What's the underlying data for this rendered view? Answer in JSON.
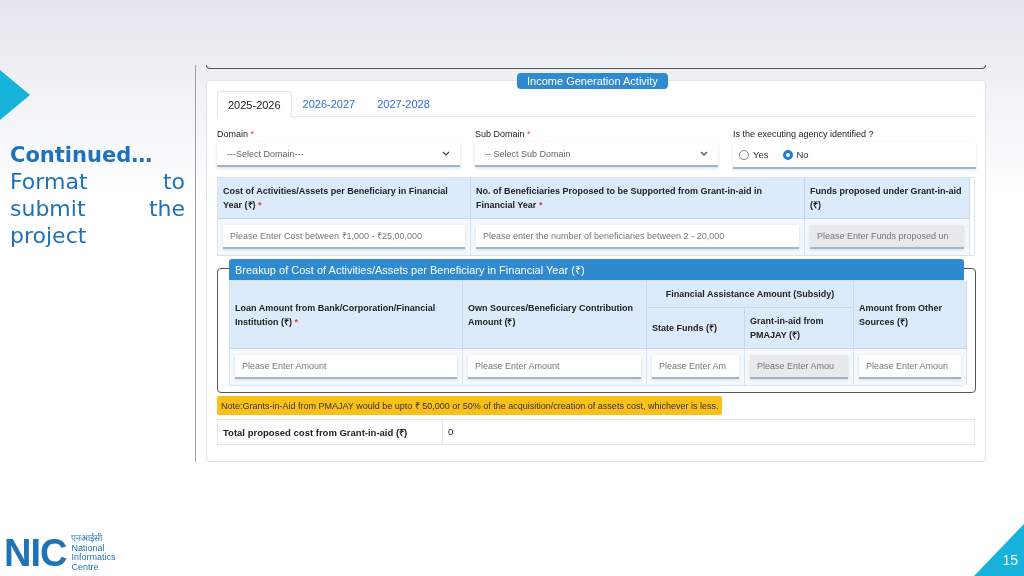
{
  "slide": {
    "heading": "Continued…",
    "text": "Format to submit the project",
    "page_number": "15",
    "logo": {
      "letters": "NIC",
      "hindi": "एनआईसी",
      "name_lines": [
        "National",
        "Informatics",
        "Centre"
      ]
    }
  },
  "form": {
    "section_badge": "Income Generation Activity",
    "tabs": [
      {
        "label": "2025-2026",
        "selected": true
      },
      {
        "label": "2026-2027",
        "selected": false
      },
      {
        "label": "2027-2028",
        "selected": false
      }
    ],
    "domain": {
      "label": "Domain",
      "required_mark": "*",
      "placeholder": "---Select Domain---"
    },
    "sub_domain": {
      "label": "Sub Domain",
      "required_mark": "*",
      "placeholder": "-- Select Sub Domain"
    },
    "agency": {
      "label": "Is the executing agency identified ?",
      "options": [
        {
          "label": "Yes",
          "selected": false
        },
        {
          "label": "No",
          "selected": true
        }
      ]
    },
    "cost_table": {
      "columns": [
        {
          "label": "Cost of Activities/Assets per Beneficiary in Financial Year (₹)",
          "required_mark": "*",
          "placeholder": "Please Enter Cost between ₹1,000 - ₹25,00,000",
          "disabled": false
        },
        {
          "label": "No. of Beneficiaries Proposed to be Supported from Grant-in-aid in Financial Year",
          "required_mark": "*",
          "placeholder": "Please enter the number of beneficiaries between 2 - 20,000",
          "disabled": false
        },
        {
          "label": "Funds proposed under Grant-in-aid (₹)",
          "placeholder": "Please Enter Funds proposed un",
          "disabled": true
        }
      ]
    },
    "breakup": {
      "title": "Breakup of Cost of Activities/Assets per Beneficiary in Financial Year (₹)",
      "columns": [
        {
          "kind": "single",
          "label": "Loan Amount from Bank/Corporation/Financial Institution (₹)",
          "required_mark": "*",
          "placeholder": "Please Enter Amount",
          "disabled": false
        },
        {
          "kind": "single",
          "label": "Own Sources/Beneficiary Contribution Amount (₹)",
          "placeholder": "Please Enter Amount",
          "disabled": false
        },
        {
          "kind": "group",
          "label": "Financial Assistance Amount (Subsidy)",
          "children": [
            {
              "label": "State Funds (₹)",
              "placeholder": "Please Enter Am",
              "disabled": false
            },
            {
              "label": "Grant-in-aid from PMAJAY (₹)",
              "placeholder": "Please Enter Amou",
              "disabled": true
            }
          ]
        },
        {
          "kind": "single",
          "label": "Amount from Other Sources (₹)",
          "placeholder": "Please Enter Amoun",
          "disabled": false
        }
      ]
    },
    "note": "Note:Grants-in-Aid from PMAJAY would be upto ₹ 50,000 or 50% of the acquisition/creation of assets cost, whichever is less.",
    "total": {
      "label": "Total proposed cost from Grant-in-aid (₹)",
      "value": "0"
    }
  }
}
